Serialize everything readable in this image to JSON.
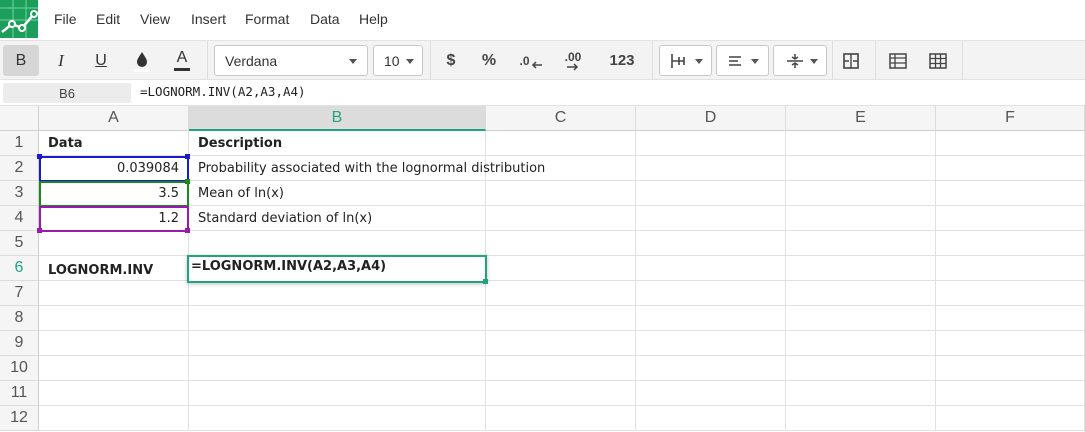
{
  "menu": [
    "File",
    "Edit",
    "View",
    "Insert",
    "Format",
    "Data",
    "Help"
  ],
  "toolbar": {
    "bold": "B",
    "italic": "I",
    "underline": "U",
    "text_color_glyph": "A",
    "font_name": "Verdana",
    "font_size": "10",
    "currency": "$",
    "percent": "%",
    "decrease_decimals": ".0",
    "increase_decimals": ".00",
    "number_format": "123"
  },
  "formula_bar": {
    "cell_ref": "B6",
    "formula": "=LOGNORM.INV(A2,A3,A4)"
  },
  "sheet": {
    "columns": [
      "A",
      "B",
      "C",
      "D",
      "E",
      "F"
    ],
    "rows": [
      "1",
      "2",
      "3",
      "4",
      "5",
      "6",
      "7",
      "8",
      "9",
      "10",
      "11",
      "12"
    ],
    "selected_column": "B",
    "selected_row": "6",
    "cells": {
      "A1": "Data",
      "B1": "Description",
      "A2": "0.039084",
      "B2": "Probability associated with the lognormal distribution",
      "A3": "3.5",
      "B3": "Mean of ln(x)",
      "A4": "1.2",
      "B4": "Standard deviation of ln(x)",
      "A6": "LOGNORM.INV"
    },
    "editing_cell": "=LOGNORM.INV(A2,A3,A4)"
  },
  "colors": {
    "accent": "#20a47f",
    "ref_a2": "#1a1ad0",
    "ref_a3": "#1a8a1a",
    "ref_a4": "#9a1ab0"
  }
}
